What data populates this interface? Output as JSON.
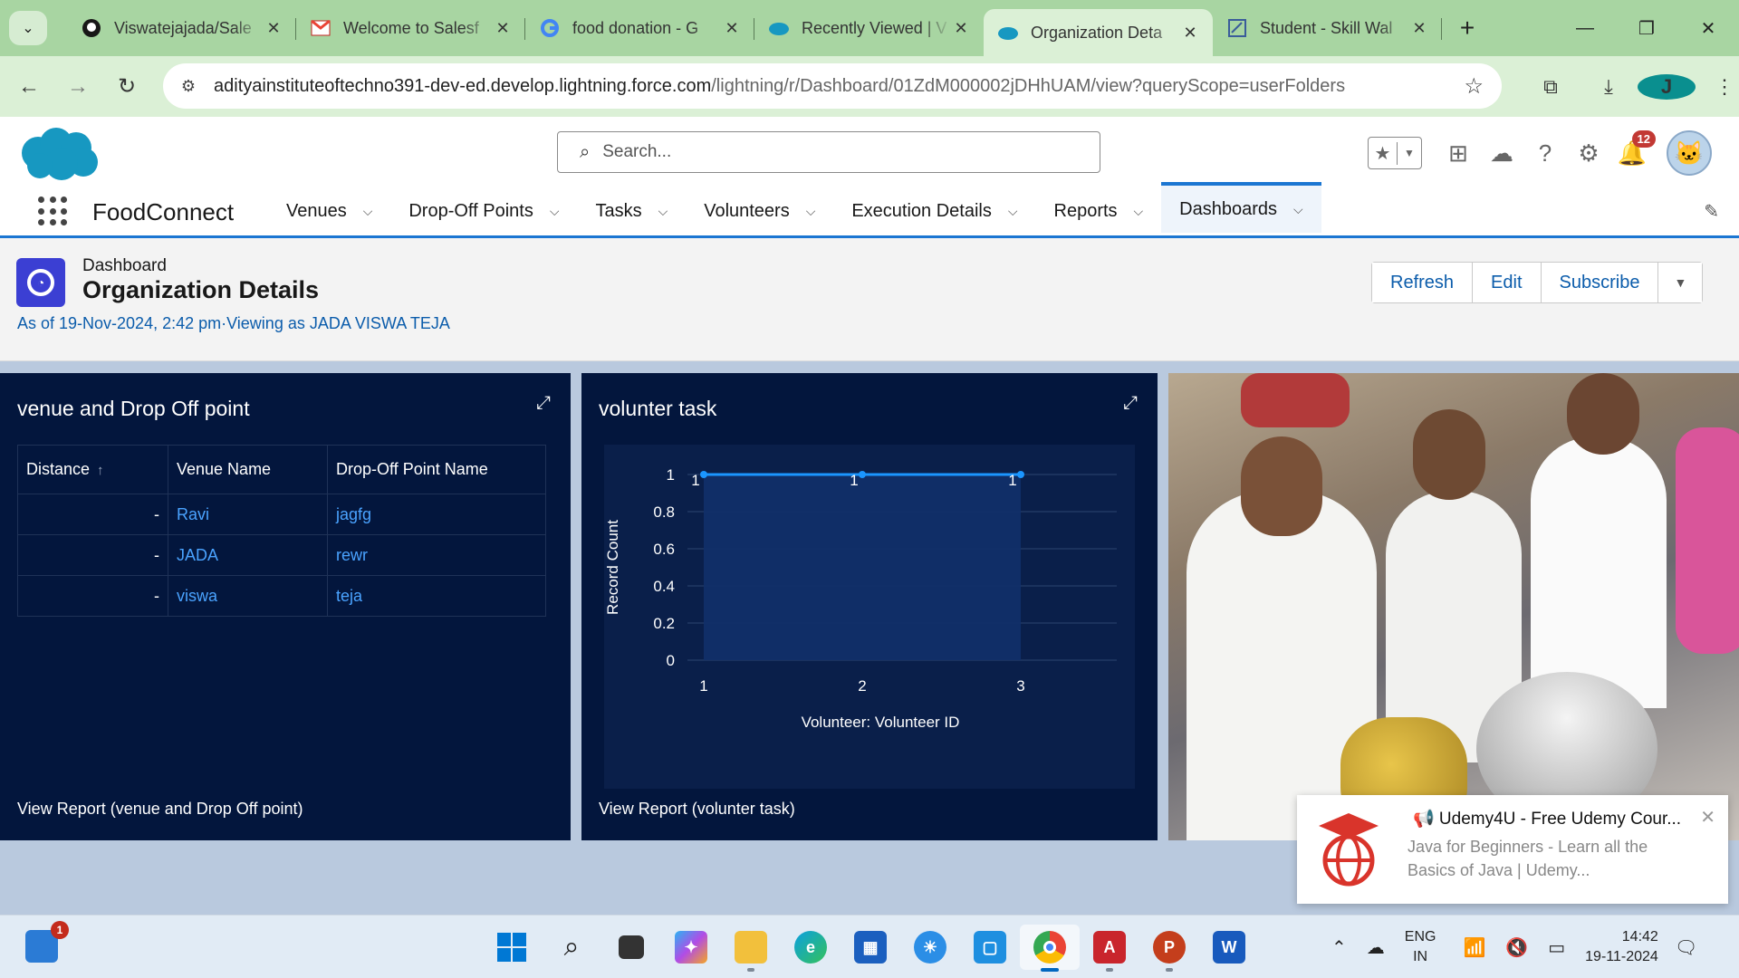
{
  "browser": {
    "tabs": [
      {
        "title": "Viswatejajada/Sale",
        "icon": "github-icon"
      },
      {
        "title": "Welcome to Salesf",
        "icon": "gmail-icon"
      },
      {
        "title": "food donation - G",
        "icon": "google-icon"
      },
      {
        "title": "Recently Viewed | V",
        "icon": "salesforce-cloud-icon"
      },
      {
        "title": "Organization Deta",
        "icon": "salesforce-cloud-icon",
        "active": true
      },
      {
        "title": "Student - Skill Wal",
        "icon": "skillwallet-icon"
      }
    ],
    "url_host": "adityainstituteoftechno391-dev-ed.develop.lightning.force.com",
    "url_path": "/lightning/r/Dashboard/01ZdM000002jDHhUAM/view?queryScope=userFolders",
    "profile_initial": "J"
  },
  "sf": {
    "search_placeholder": "Search...",
    "notification_count": "12",
    "app_name": "FoodConnect",
    "nav": [
      "Venues",
      "Drop-Off Points",
      "Tasks",
      "Volunteers",
      "Execution Details",
      "Reports",
      "Dashboards"
    ],
    "active_nav": "Dashboards"
  },
  "page": {
    "type_label": "Dashboard",
    "title": "Organization Details",
    "meta": "As of 19-Nov-2024, 2:42 pm·Viewing as JADA VISWA TEJA",
    "buttons": {
      "refresh": "Refresh",
      "edit": "Edit",
      "subscribe": "Subscribe"
    }
  },
  "widget1": {
    "title": "venue and Drop Off point",
    "columns": [
      "Distance",
      "Venue Name",
      "Drop-Off Point Name"
    ],
    "rows": [
      {
        "distance": "-",
        "venue": "Ravi",
        "dropoff": "jagfg"
      },
      {
        "distance": "-",
        "venue": "JADA",
        "dropoff": "rewr"
      },
      {
        "distance": "-",
        "venue": "viswa",
        "dropoff": "teja"
      }
    ],
    "footer": "View Report (venue and Drop Off point)"
  },
  "widget2": {
    "title": "volunter task",
    "footer": "View Report (volunter task)"
  },
  "chart_data": {
    "type": "area",
    "x": [
      "1",
      "2",
      "3"
    ],
    "series": [
      {
        "values": [
          1,
          1,
          1
        ]
      }
    ],
    "data_labels": [
      "1",
      "1",
      "1"
    ],
    "xlabel": "Volunteer: Volunteer ID",
    "ylabel": "Record Count",
    "yticks": [
      "0",
      "0.2",
      "0.4",
      "0.6",
      "0.8",
      "1"
    ],
    "ylim": [
      0,
      1
    ],
    "grid": true,
    "colors": {
      "line": "#1b96ff",
      "fill": "#112f68",
      "bg": "#0a1f4a"
    }
  },
  "toast": {
    "title": "📢 Udemy4U - Free Udemy Cour...",
    "body": "Java for Beginners - Learn all the Basics of Java | Udemy..."
  },
  "taskbar": {
    "widget_badge": "1",
    "lang_line1": "ENG",
    "lang_line2": "IN",
    "time": "14:42",
    "date": "19-11-2024"
  }
}
